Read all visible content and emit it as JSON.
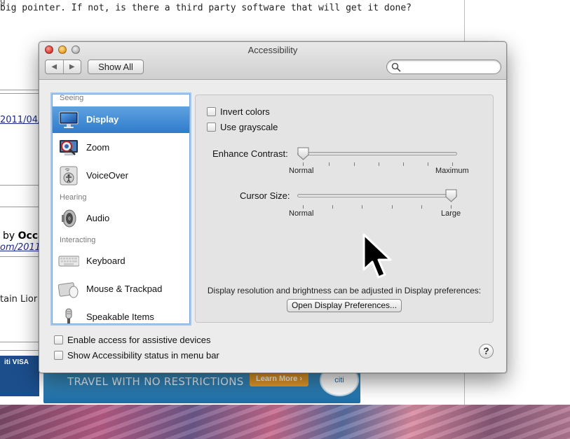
{
  "background_page": {
    "line1": "big pointer. If not, is there a third party software that will get it done?",
    "date_link": "2011/04/",
    "by_label": "by",
    "author": "Occa",
    "url_fragment": "om/2011",
    "partial_text": "tain Lior",
    "ad_text": "TRAVEL WITH NO RESTRICTIONS",
    "ad_button": "Learn More ›",
    "ad_logo": "citi",
    "card_text": "iti VISA",
    "card_text2": "VISA"
  },
  "window": {
    "title": "Accessibility",
    "show_all_label": "Show All",
    "nav_back": "◀",
    "nav_forward": "▶",
    "search_placeholder": ""
  },
  "sidebar": {
    "sections": [
      {
        "heading": "Seeing"
      },
      {
        "heading": "Hearing"
      },
      {
        "heading": "Interacting"
      }
    ],
    "items": [
      {
        "label": "Display",
        "icon": "display-icon",
        "selected": true
      },
      {
        "label": "Zoom",
        "icon": "zoom-icon"
      },
      {
        "label": "VoiceOver",
        "icon": "voiceover-icon"
      },
      {
        "label": "Audio",
        "icon": "speaker-icon"
      },
      {
        "label": "Keyboard",
        "icon": "keyboard-icon"
      },
      {
        "label": "Mouse & Trackpad",
        "icon": "mouse-trackpad-icon"
      },
      {
        "label": "Speakable Items",
        "icon": "microphone-icon"
      }
    ]
  },
  "display_pane": {
    "invert_colors": {
      "label": "Invert colors",
      "checked": false
    },
    "use_grayscale": {
      "label": "Use grayscale",
      "checked": false
    },
    "enhance_contrast": {
      "label": "Enhance Contrast:",
      "min_label": "Normal",
      "max_label": "Maximum",
      "value": 0.0
    },
    "cursor_size": {
      "label": "Cursor Size:",
      "min_label": "Normal",
      "max_label": "Large",
      "value": 1.0
    },
    "info_text": "Display resolution and brightness can be adjusted in Display preferences:",
    "open_display_button": "Open Display Preferences..."
  },
  "bottom": {
    "enable_assistive": {
      "label": "Enable access for assistive devices",
      "checked": false
    },
    "show_status": {
      "label": "Show Accessibility status in menu bar",
      "checked": false
    },
    "help_label": "?"
  },
  "colors": {
    "selection": "#2f7bcc",
    "window_bg": "#ececec",
    "pane_bg": "#e4e4e4"
  }
}
